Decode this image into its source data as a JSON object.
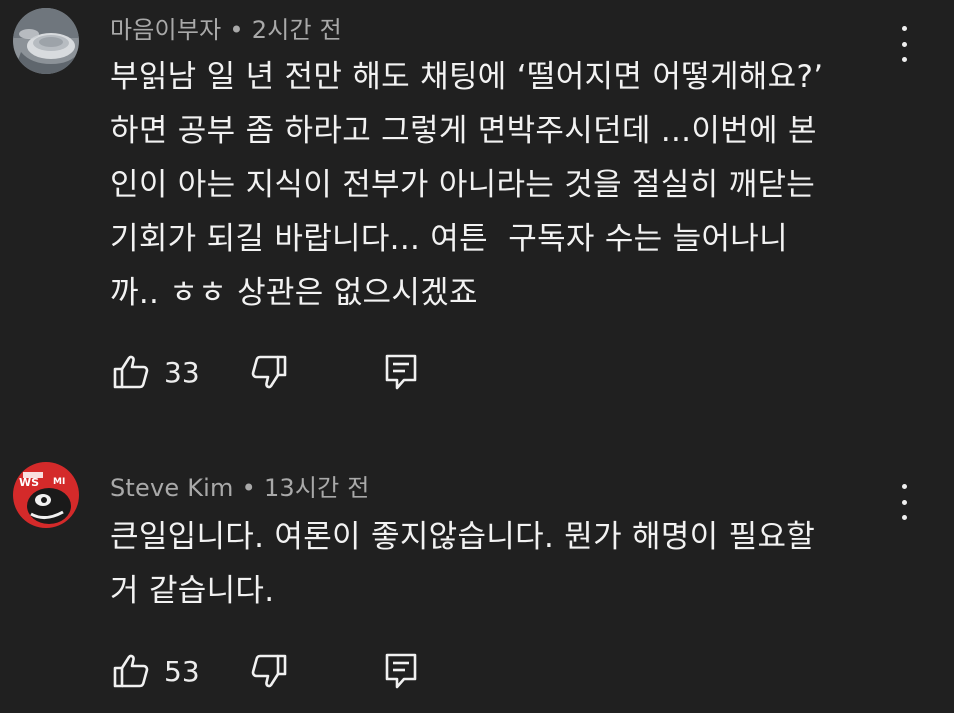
{
  "comments": [
    {
      "author": "마음이부자",
      "separator": "•",
      "time": "2시간 전",
      "text": "부읽남 일 년 전만 해도 채팅에 ‘떨어지면 어떻게해요?’\n하면 공부 좀 하라고 그렇게 면박주시던데 ...이번에 본\n인이 아는 지식이 전부가 아니라는 것을 절실히 깨닫는\n기회가 되길 바랍니다... 여튼  구독자 수는 늘어나니\n까.. ㅎㅎ 상관은 없으시겠죠",
      "likes": "33",
      "avatar_icon": "coffee-cup-photo-avatar"
    },
    {
      "author": "Steve Kim",
      "separator": "•",
      "time": "13시간 전",
      "text": "큰일입니다. 여론이 좋지않습니다. 뭔가 해명이 필요할\n거 같습니다.",
      "likes": "53",
      "avatar_icon": "red-cartoon-avatar"
    }
  ],
  "icons": {
    "like": "thumbs-up-icon",
    "dislike": "thumbs-down-icon",
    "reply": "reply-comment-icon",
    "more": "more-vertical-icon"
  },
  "colors": {
    "background": "#202020",
    "text": "#f1f1f1",
    "meta": "#a9a9a9"
  }
}
